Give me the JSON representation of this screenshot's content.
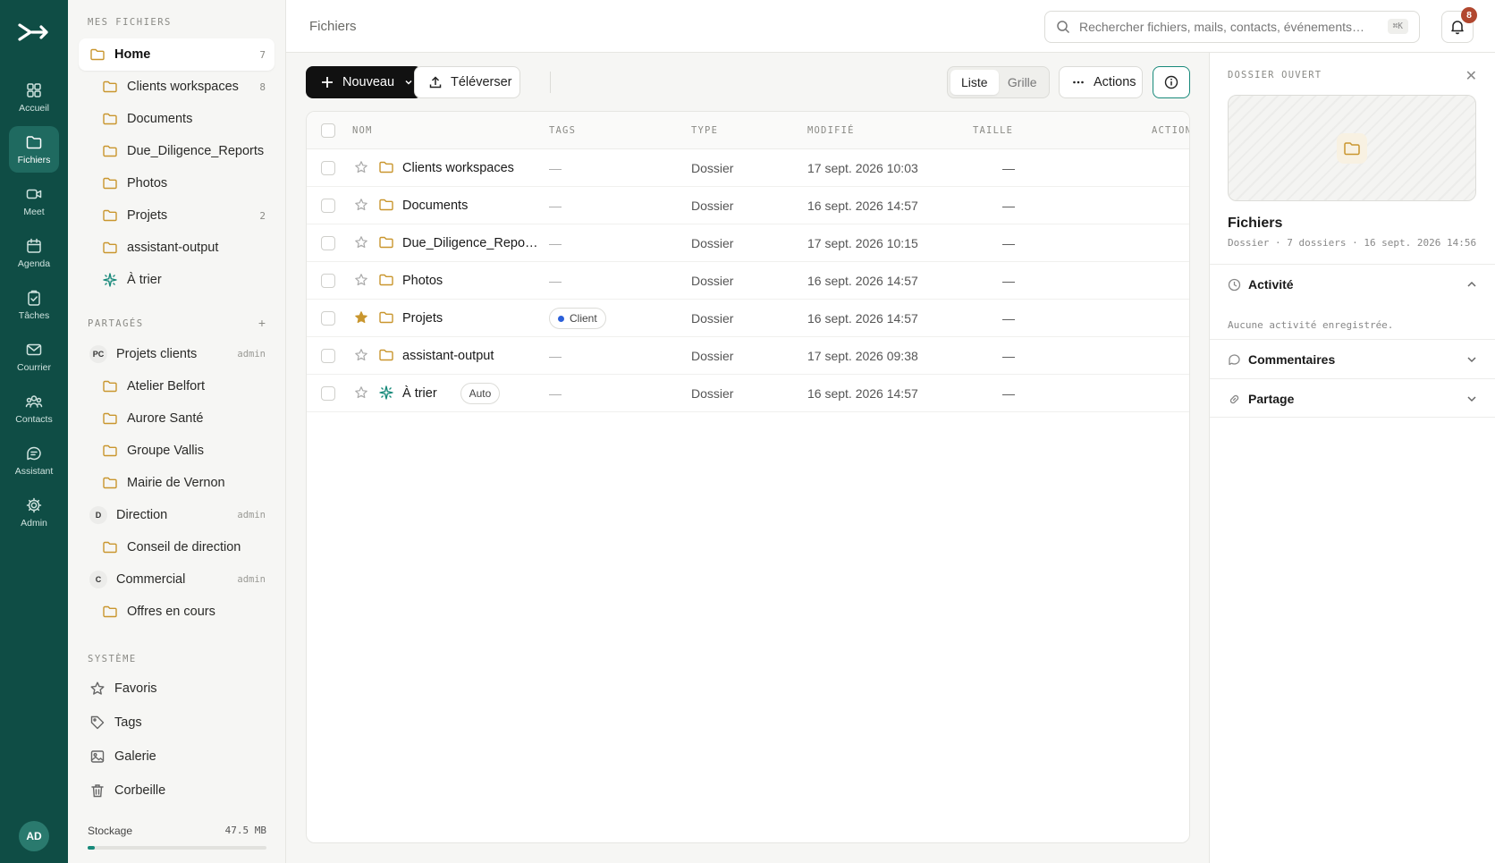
{
  "colors": {
    "rail_bg": "#0f4d45",
    "accent": "#17897a",
    "folder": "#c9962e",
    "star_filled": "#c9962e",
    "notif": "#b1472f"
  },
  "rail": {
    "items": [
      {
        "label": "Accueil",
        "icon": "grid-icon"
      },
      {
        "label": "Fichiers",
        "icon": "folder-icon"
      },
      {
        "label": "Meet",
        "icon": "video-icon"
      },
      {
        "label": "Agenda",
        "icon": "calendar-icon"
      },
      {
        "label": "Tâches",
        "icon": "clipboard-check-icon"
      },
      {
        "label": "Courrier",
        "icon": "mail-icon"
      },
      {
        "label": "Contacts",
        "icon": "users-icon"
      },
      {
        "label": "Assistant",
        "icon": "chat-icon"
      },
      {
        "label": "Admin",
        "icon": "gear-icon"
      }
    ],
    "active": "Fichiers",
    "avatar": "AD"
  },
  "sidebar": {
    "my_files_title": "MES FICHIERS",
    "home": {
      "label": "Home",
      "count": "7"
    },
    "my_items": [
      {
        "label": "Clients workspaces",
        "count": "8"
      },
      {
        "label": "Documents",
        "count": ""
      },
      {
        "label": "Due_Diligence_Reports",
        "count": ""
      },
      {
        "label": "Photos",
        "count": ""
      },
      {
        "label": "Projets",
        "count": "2"
      },
      {
        "label": "assistant-output",
        "count": ""
      },
      {
        "label": "À trier",
        "count": ""
      }
    ],
    "shared_title": "PARTAGÉS",
    "shared_add": "+",
    "shared": [
      {
        "initials": "PC",
        "label": "Projets clients",
        "role": "admin",
        "children": [
          "Atelier Belfort",
          "Aurore Santé",
          "Groupe Vallis",
          "Mairie de Vernon"
        ]
      },
      {
        "initials": "D",
        "label": "Direction",
        "role": "admin",
        "children": [
          "Conseil de direction"
        ]
      },
      {
        "initials": "C",
        "label": "Commercial",
        "role": "admin",
        "children": [
          "Offres en cours"
        ]
      }
    ],
    "system_title": "SYSTÈME",
    "system": [
      {
        "label": "Favoris",
        "icon": "star-icon"
      },
      {
        "label": "Tags",
        "icon": "tag-icon"
      },
      {
        "label": "Galerie",
        "icon": "image-icon"
      },
      {
        "label": "Corbeille",
        "icon": "trash-icon"
      }
    ],
    "storage": {
      "label": "Stockage",
      "value": "47.5 MB",
      "fraction": 0.04
    }
  },
  "topbar": {
    "title": "Fichiers",
    "search_placeholder": "Rechercher fichiers, mails, contacts, événements…",
    "search_shortcut": "⌘K",
    "notifications": "8"
  },
  "toolbar": {
    "new_label": "Nouveau",
    "upload_label": "Téléverser",
    "view_list": "Liste",
    "view_grid": "Grille",
    "actions_label": "Actions"
  },
  "table": {
    "headers": {
      "name": "NOM",
      "tags": "TAGS",
      "type": "TYPE",
      "modified": "MODIFIÉ",
      "size": "TAILLE",
      "actions": "ACTIONS"
    },
    "rows": [
      {
        "name": "Clients workspaces",
        "tag": "—",
        "type": "Dossier",
        "modified": "17 sept. 2026 10:03",
        "size": "—",
        "starred": false
      },
      {
        "name": "Documents",
        "tag": "—",
        "type": "Dossier",
        "modified": "16 sept. 2026 14:57",
        "size": "—",
        "starred": false
      },
      {
        "name": "Due_Diligence_Repo…",
        "tag": "—",
        "type": "Dossier",
        "modified": "17 sept. 2026 10:15",
        "size": "—",
        "starred": false
      },
      {
        "name": "Photos",
        "tag": "—",
        "type": "Dossier",
        "modified": "16 sept. 2026 14:57",
        "size": "—",
        "starred": false
      },
      {
        "name": "Projets",
        "tag": "Client",
        "type": "Dossier",
        "modified": "16 sept. 2026 14:57",
        "size": "—",
        "starred": true
      },
      {
        "name": "assistant-output",
        "tag": "—",
        "type": "Dossier",
        "modified": "17 sept. 2026 09:38",
        "size": "—",
        "starred": false
      },
      {
        "name": "À trier",
        "badge": "Auto",
        "tag": "—",
        "type": "Dossier",
        "modified": "16 sept. 2026 14:57",
        "size": "—",
        "starred": false
      }
    ]
  },
  "panel": {
    "title": "DOSSIER OUVERT",
    "name": "Fichiers",
    "meta": "Dossier · 7 dossiers · 16 sept. 2026 14:56",
    "activity_label": "Activité",
    "activity_empty": "Aucune activité enregistrée.",
    "comments_label": "Commentaires",
    "sharing_label": "Partage"
  }
}
